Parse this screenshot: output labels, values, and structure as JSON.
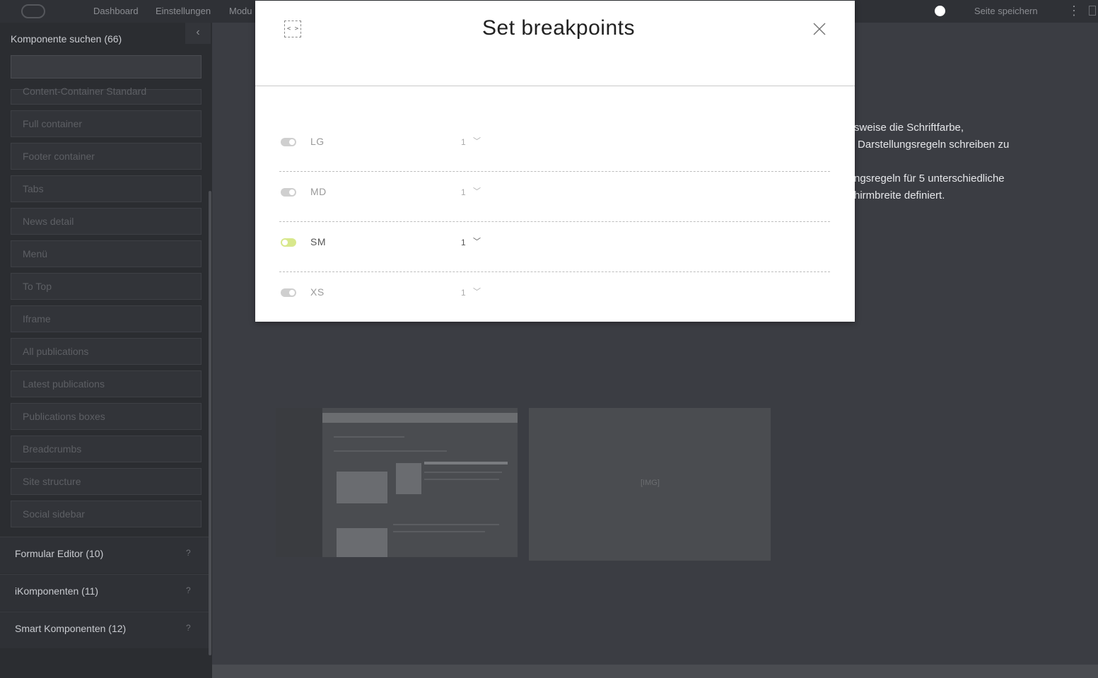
{
  "topbar": {
    "nav": [
      "Dashboard",
      "Einstellungen",
      "Modu"
    ],
    "save_label": "Seite speichern"
  },
  "sidebar": {
    "title": "Komponente suchen (66)",
    "search_value": "",
    "items": [
      "Content-Container Standard",
      "Full container",
      "Footer container",
      "Tabs",
      "News detail",
      "Menü",
      "To Top",
      "Iframe",
      "All publications",
      "Latest publications",
      "Publications boxes",
      "Breadcrumbs",
      "Site structure",
      "Social sidebar"
    ],
    "sections": [
      {
        "label": "Formular Editor (10)",
        "help": "?"
      },
      {
        "label": "iKomponenten (11)",
        "help": "?"
      },
      {
        "label": "Smart Komponenten (12)",
        "help": "?"
      }
    ]
  },
  "main": {
    "text_lines": [
      "sweise die Schriftfarbe,",
      "Darstellungsregeln schreiben zu",
      "ngsregeln für 5 unterschiedliche",
      "hirmbreite definiert."
    ],
    "placeholder_text": "[IMG]"
  },
  "modal": {
    "title": "Set breakpoints",
    "rows": [
      {
        "label": "LG",
        "value": "1",
        "enabled": false
      },
      {
        "label": "MD",
        "value": "1",
        "enabled": false
      },
      {
        "label": "SM",
        "value": "1",
        "enabled": true
      },
      {
        "label": "XS",
        "value": "1",
        "enabled": false
      }
    ]
  }
}
